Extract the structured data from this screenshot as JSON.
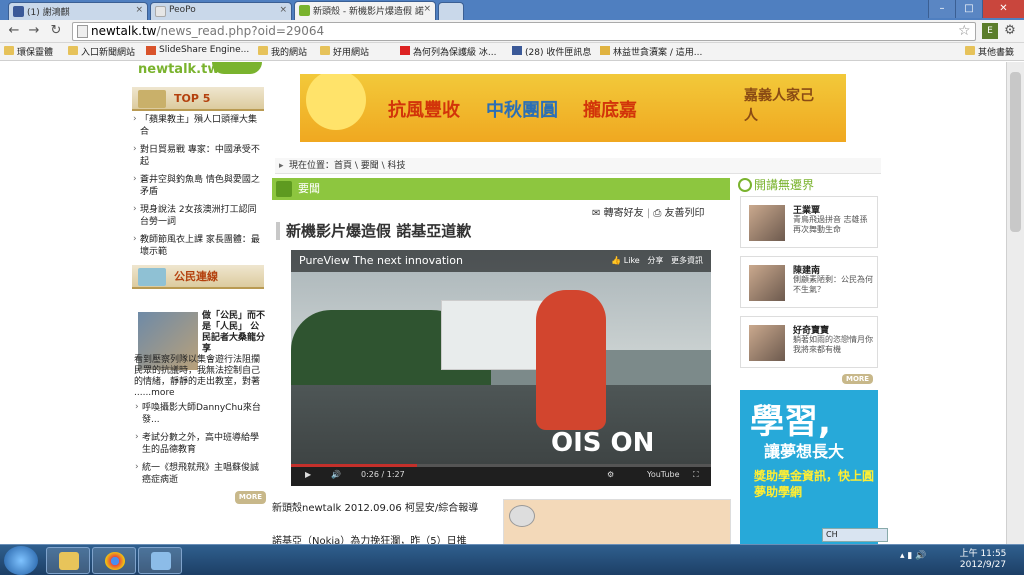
{
  "tabs": [
    {
      "label": "(1) 謝鴻麒",
      "active": false
    },
    {
      "label": "PeoPo",
      "active": false
    },
    {
      "label": "新頭殼 - 新機影片爆造假 諾",
      "active": true
    }
  ],
  "address": {
    "host": "newtalk.tw",
    "path": "/news_read.php?oid=29064"
  },
  "bookmarks": [
    "環保靈體",
    "入口新聞網站",
    "SlideShare Engine...",
    "我的網站",
    "好用網站",
    "為何列為保護級 冰...",
    "(28) 收件匣訊息",
    "林益世貪瀆案 / 這用...",
    "其他書籤"
  ],
  "site": {
    "logo": "newtalk.tw"
  },
  "banner": {
    "t1": "抗風豐收",
    "t2": "中秋團圓",
    "t3": "攏底嘉",
    "t4": "嘉義人家己人"
  },
  "top5": {
    "title": "TOP 5",
    "items": [
      "「蘋果教主」殞人口頭禪大集合",
      "對日貿易戰 專家：中國承受不起",
      "蒼井空與釣魚島 情色與愛國之矛盾",
      "現身說法 2女孩澳洲打工認同台勞一詞",
      "教師節風衣上課 家長團體：最壞示範"
    ]
  },
  "citizen": {
    "title": "公民連線",
    "headline": "做「公民」而不是「人民」 公民記者大桑龍分享",
    "body": "看到壓察列隊以集會遊行法阻攔民眾的抗議時，我無法控制自己的情緒，靜靜的走出教室，對著 ......more",
    "items": [
      "呼喚攝影大師DannyChu來台發...",
      "考試分數之外，高中班導給學生的品德教育",
      "統一《想飛就飛》主唱蘇俊誠癌症病逝"
    ],
    "more": "MORE"
  },
  "breadcrumb": "現在位置：首頁 \\ 要聞 \\ 科技",
  "category": "要聞",
  "share": {
    "forward": "轉寄好友",
    "print": "友善列印"
  },
  "article": {
    "title": "新機影片爆造假 諾基亞道歉",
    "byline": "新頭殼newtalk 2012.09.06 柯昱安/綜合報導",
    "lead": "諾基亞（Nokia）為力挽狂瀾，昨（5）日推"
  },
  "video": {
    "title": "PureView The next innovation",
    "like": "Like",
    "share": "分享",
    "more": "更多資訊",
    "overlay": "OIS ON",
    "time": "0:26 / 1:27",
    "progress": 0.3
  },
  "sidebar_right": {
    "title": "開講無遷界",
    "cards": [
      {
        "name": "王業覃",
        "desc": "青鳥飛過拼音 志雄孫再次舞動生命"
      },
      {
        "name": "陳建南",
        "desc": "側顧素陋剩：公民為何不生氣？"
      },
      {
        "name": "好奇寶寶",
        "desc": "躺著如雨的恣戀情月你我將來都有機"
      }
    ],
    "more": "MORE"
  },
  "ad2": {
    "t1": "學習,",
    "t2": "讓夢想長大",
    "t3": "獎助學金資訊，快上圓夢助學網"
  },
  "taskbar": {
    "ime": "CH",
    "clock_time": "上午 11:55",
    "clock_date": "2012/9/27"
  }
}
